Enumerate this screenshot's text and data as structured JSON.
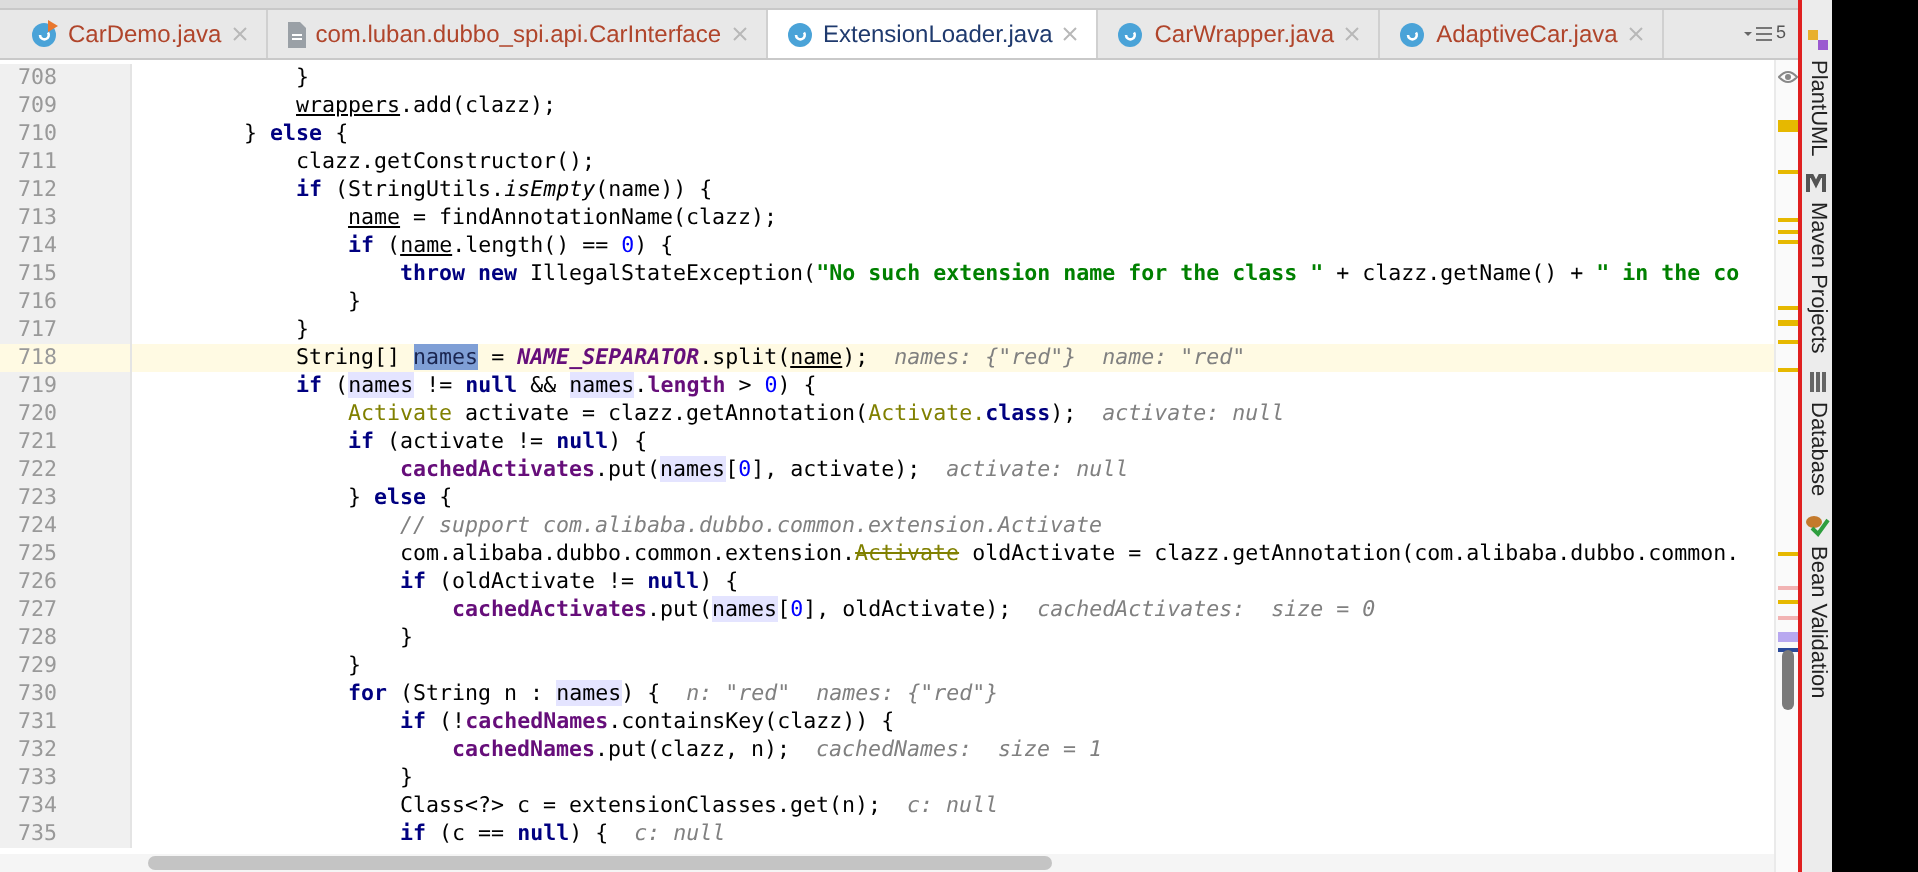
{
  "tabs": [
    {
      "label": "CarDemo.java",
      "kind": "runnable-class",
      "selected": false
    },
    {
      "label": "com.luban.dubbo_spi.api.CarInterface",
      "kind": "file",
      "selected": false
    },
    {
      "label": "ExtensionLoader.java",
      "kind": "class",
      "selected": true
    },
    {
      "label": "CarWrapper.java",
      "kind": "class",
      "selected": false
    },
    {
      "label": "AdaptiveCar.java",
      "kind": "class",
      "selected": false
    }
  ],
  "tab_overflow": {
    "count": "5"
  },
  "code": {
    "lines": [
      {
        "number": "708",
        "current": false,
        "segments": [
          {
            "text": "            }",
            "kind": "plain"
          }
        ]
      },
      {
        "number": "709",
        "current": false,
        "segments": [
          {
            "text": "            wrappers",
            "kind": "underlined"
          },
          {
            "text": ".add(clazz);",
            "kind": "plain"
          }
        ]
      },
      {
        "number": "710",
        "current": false,
        "segments": [
          {
            "text": "        } ",
            "kind": "plain"
          },
          {
            "text": "else",
            "kind": "keyword"
          },
          {
            "text": " {",
            "kind": "plain"
          }
        ]
      },
      {
        "number": "711",
        "current": false,
        "segments": [
          {
            "text": "            clazz.getConstructor();",
            "kind": "plain"
          }
        ]
      },
      {
        "number": "712",
        "current": false,
        "segments": [
          {
            "text": "            if",
            "kind": "keyword"
          },
          {
            "text": " (StringUtils.",
            "kind": "plain"
          },
          {
            "text": "isEmpty",
            "kind": "static"
          },
          {
            "text": "(name)) {",
            "kind": "plain"
          }
        ]
      },
      {
        "number": "713",
        "current": false,
        "segments": [
          {
            "text": "                name",
            "kind": "underlined"
          },
          {
            "text": " = findAnnotationName(clazz);",
            "kind": "plain"
          }
        ]
      },
      {
        "number": "714",
        "current": false,
        "segments": [
          {
            "text": "                if",
            "kind": "keyword"
          },
          {
            "text": " (",
            "kind": "plain"
          },
          {
            "text": "name",
            "kind": "underlined"
          },
          {
            "text": ".length() == ",
            "kind": "plain"
          },
          {
            "text": "0",
            "kind": "number"
          },
          {
            "text": ") {",
            "kind": "plain"
          }
        ]
      },
      {
        "number": "715",
        "current": false,
        "segments": [
          {
            "text": "                    throw new",
            "kind": "keyword"
          },
          {
            "text": " IllegalStateException(",
            "kind": "plain"
          },
          {
            "text": "\"No such extension name for the class \"",
            "kind": "string"
          },
          {
            "text": " + clazz.getName() + ",
            "kind": "plain"
          },
          {
            "text": "\" in the co",
            "kind": "string"
          }
        ]
      },
      {
        "number": "716",
        "current": false,
        "segments": [
          {
            "text": "                }",
            "kind": "plain"
          }
        ]
      },
      {
        "number": "717",
        "current": false,
        "segments": [
          {
            "text": "            }",
            "kind": "plain"
          }
        ]
      },
      {
        "number": "718",
        "current": true,
        "segments": [
          {
            "text": "            String[] ",
            "kind": "plain"
          },
          {
            "text": "names",
            "kind": "selected"
          },
          {
            "text": " = ",
            "kind": "plain"
          },
          {
            "text": "NAME_SEPARATOR",
            "kind": "constant"
          },
          {
            "text": ".split(",
            "kind": "plain"
          },
          {
            "text": "name",
            "kind": "underlined"
          },
          {
            "text": ");",
            "kind": "plain"
          },
          {
            "text": "names: {\"red\"}  name: \"red\"",
            "kind": "hint"
          }
        ]
      },
      {
        "number": "719",
        "current": false,
        "segments": [
          {
            "text": "            if",
            "kind": "keyword"
          },
          {
            "text": " (",
            "kind": "plain"
          },
          {
            "text": "names",
            "kind": "usage"
          },
          {
            "text": " != ",
            "kind": "plain"
          },
          {
            "text": "null",
            "kind": "keyword"
          },
          {
            "text": " && ",
            "kind": "plain"
          },
          {
            "text": "names",
            "kind": "usage"
          },
          {
            "text": ".",
            "kind": "plain"
          },
          {
            "text": "length",
            "kind": "field"
          },
          {
            "text": " > ",
            "kind": "plain"
          },
          {
            "text": "0",
            "kind": "number"
          },
          {
            "text": ") {",
            "kind": "plain"
          }
        ]
      },
      {
        "number": "720",
        "current": false,
        "segments": [
          {
            "text": "                Activate",
            "kind": "type"
          },
          {
            "text": " activate = clazz.getAnnotation(",
            "kind": "plain"
          },
          {
            "text": "Activate.",
            "kind": "type"
          },
          {
            "text": "class",
            "kind": "keyword"
          },
          {
            "text": ");",
            "kind": "plain"
          },
          {
            "text": "activate: null",
            "kind": "hint"
          }
        ]
      },
      {
        "number": "721",
        "current": false,
        "segments": [
          {
            "text": "                if",
            "kind": "keyword"
          },
          {
            "text": " (activate != ",
            "kind": "plain"
          },
          {
            "text": "null",
            "kind": "keyword"
          },
          {
            "text": ") {",
            "kind": "plain"
          }
        ]
      },
      {
        "number": "722",
        "current": false,
        "segments": [
          {
            "text": "                    cachedActivates",
            "kind": "field"
          },
          {
            "text": ".put(",
            "kind": "plain"
          },
          {
            "text": "names",
            "kind": "usage"
          },
          {
            "text": "[",
            "kind": "plain"
          },
          {
            "text": "0",
            "kind": "number"
          },
          {
            "text": "], activate);",
            "kind": "plain"
          },
          {
            "text": "activate: null",
            "kind": "hint"
          }
        ]
      },
      {
        "number": "723",
        "current": false,
        "segments": [
          {
            "text": "                } ",
            "kind": "plain"
          },
          {
            "text": "else",
            "kind": "keyword"
          },
          {
            "text": " {",
            "kind": "plain"
          }
        ]
      },
      {
        "number": "724",
        "current": false,
        "segments": [
          {
            "text": "                    // support com.alibaba.dubbo.common.extension.Activate",
            "kind": "comment"
          }
        ]
      },
      {
        "number": "725",
        "current": false,
        "segments": [
          {
            "text": "                    com.alibaba.dubbo.common.extension.",
            "kind": "plain"
          },
          {
            "text": "Activate",
            "kind": "deprecated"
          },
          {
            "text": " oldActivate = clazz.getAnnotation(com.alibaba.dubbo.common.",
            "kind": "plain"
          }
        ]
      },
      {
        "number": "726",
        "current": false,
        "segments": [
          {
            "text": "                    if",
            "kind": "keyword"
          },
          {
            "text": " (oldActivate != ",
            "kind": "plain"
          },
          {
            "text": "null",
            "kind": "keyword"
          },
          {
            "text": ") {",
            "kind": "plain"
          }
        ]
      },
      {
        "number": "727",
        "current": false,
        "segments": [
          {
            "text": "                        cachedActivates",
            "kind": "field"
          },
          {
            "text": ".put(",
            "kind": "plain"
          },
          {
            "text": "names",
            "kind": "usage"
          },
          {
            "text": "[",
            "kind": "plain"
          },
          {
            "text": "0",
            "kind": "number"
          },
          {
            "text": "], oldActivate);",
            "kind": "plain"
          },
          {
            "text": "cachedActivates:  size = 0",
            "kind": "hint"
          }
        ]
      },
      {
        "number": "728",
        "current": false,
        "segments": [
          {
            "text": "                    }",
            "kind": "plain"
          }
        ]
      },
      {
        "number": "729",
        "current": false,
        "segments": [
          {
            "text": "                }",
            "kind": "plain"
          }
        ]
      },
      {
        "number": "730",
        "current": false,
        "segments": [
          {
            "text": "                for",
            "kind": "keyword"
          },
          {
            "text": " (String n : ",
            "kind": "plain"
          },
          {
            "text": "names",
            "kind": "usage"
          },
          {
            "text": ") {",
            "kind": "plain"
          },
          {
            "text": "n: \"red\"  names: {\"red\"}",
            "kind": "hint"
          }
        ]
      },
      {
        "number": "731",
        "current": false,
        "segments": [
          {
            "text": "                    if",
            "kind": "keyword"
          },
          {
            "text": " (!",
            "kind": "plain"
          },
          {
            "text": "cachedNames",
            "kind": "field"
          },
          {
            "text": ".containsKey(clazz)) {",
            "kind": "plain"
          }
        ]
      },
      {
        "number": "732",
        "current": false,
        "segments": [
          {
            "text": "                        cachedNames",
            "kind": "field"
          },
          {
            "text": ".put(clazz, n);",
            "kind": "plain"
          },
          {
            "text": "cachedNames:  size = 1",
            "kind": "hint"
          }
        ]
      },
      {
        "number": "733",
        "current": false,
        "segments": [
          {
            "text": "                    }",
            "kind": "plain"
          }
        ]
      },
      {
        "number": "734",
        "current": false,
        "segments": [
          {
            "text": "                    Class<?> c = extensionClasses.get(n);",
            "kind": "plain"
          },
          {
            "text": "c: null",
            "kind": "hint"
          }
        ]
      },
      {
        "number": "735",
        "current": false,
        "segments": [
          {
            "text": "                    if",
            "kind": "keyword"
          },
          {
            "text": " (c == ",
            "kind": "plain"
          },
          {
            "text": "null",
            "kind": "keyword"
          },
          {
            "text": ") {",
            "kind": "plain"
          },
          {
            "text": "c: null",
            "kind": "hint"
          }
        ]
      }
    ]
  },
  "tool_windows": [
    {
      "label": "PlantUML",
      "kind": "uml"
    },
    {
      "label": "Maven Projects",
      "kind": "maven"
    },
    {
      "label": "Database",
      "kind": "database"
    },
    {
      "label": "Bean Validation",
      "kind": "bean"
    }
  ]
}
